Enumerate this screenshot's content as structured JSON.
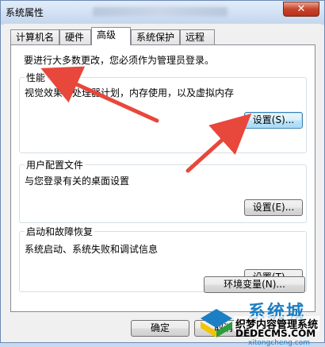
{
  "window": {
    "title": "系统属性",
    "close_label": "✕"
  },
  "tabs": [
    {
      "label": "计算机名",
      "active": false
    },
    {
      "label": "硬件",
      "active": false
    },
    {
      "label": "高级",
      "active": true
    },
    {
      "label": "系统保护",
      "active": false
    },
    {
      "label": "远程",
      "active": false
    }
  ],
  "panel": {
    "admin_note": "要进行大多数更改，您必须作为管理员登录。",
    "performance": {
      "title": "性能",
      "description": "视觉效果，处理器计划，内存使用，以及虚拟内存",
      "button": "设置(S)..."
    },
    "user_profiles": {
      "title": "用户配置文件",
      "description": "与您登录有关的桌面设置",
      "button": "设置(E)..."
    },
    "startup": {
      "title": "启动和故障恢复",
      "description": "系统启动、系统失败和调试信息",
      "button": "设置(T)..."
    },
    "env_button": "环境变量(N)..."
  },
  "footer": {
    "ok": "确定",
    "cancel": "取消"
  },
  "watermark": {
    "brand": "系统城",
    "line1": "织梦内容管理系统",
    "line2": "DEDECMS.COM",
    "small": "xitongcheng.com"
  },
  "colors": {
    "arrow": "#e8473b",
    "brand": "#1d7fc3"
  }
}
